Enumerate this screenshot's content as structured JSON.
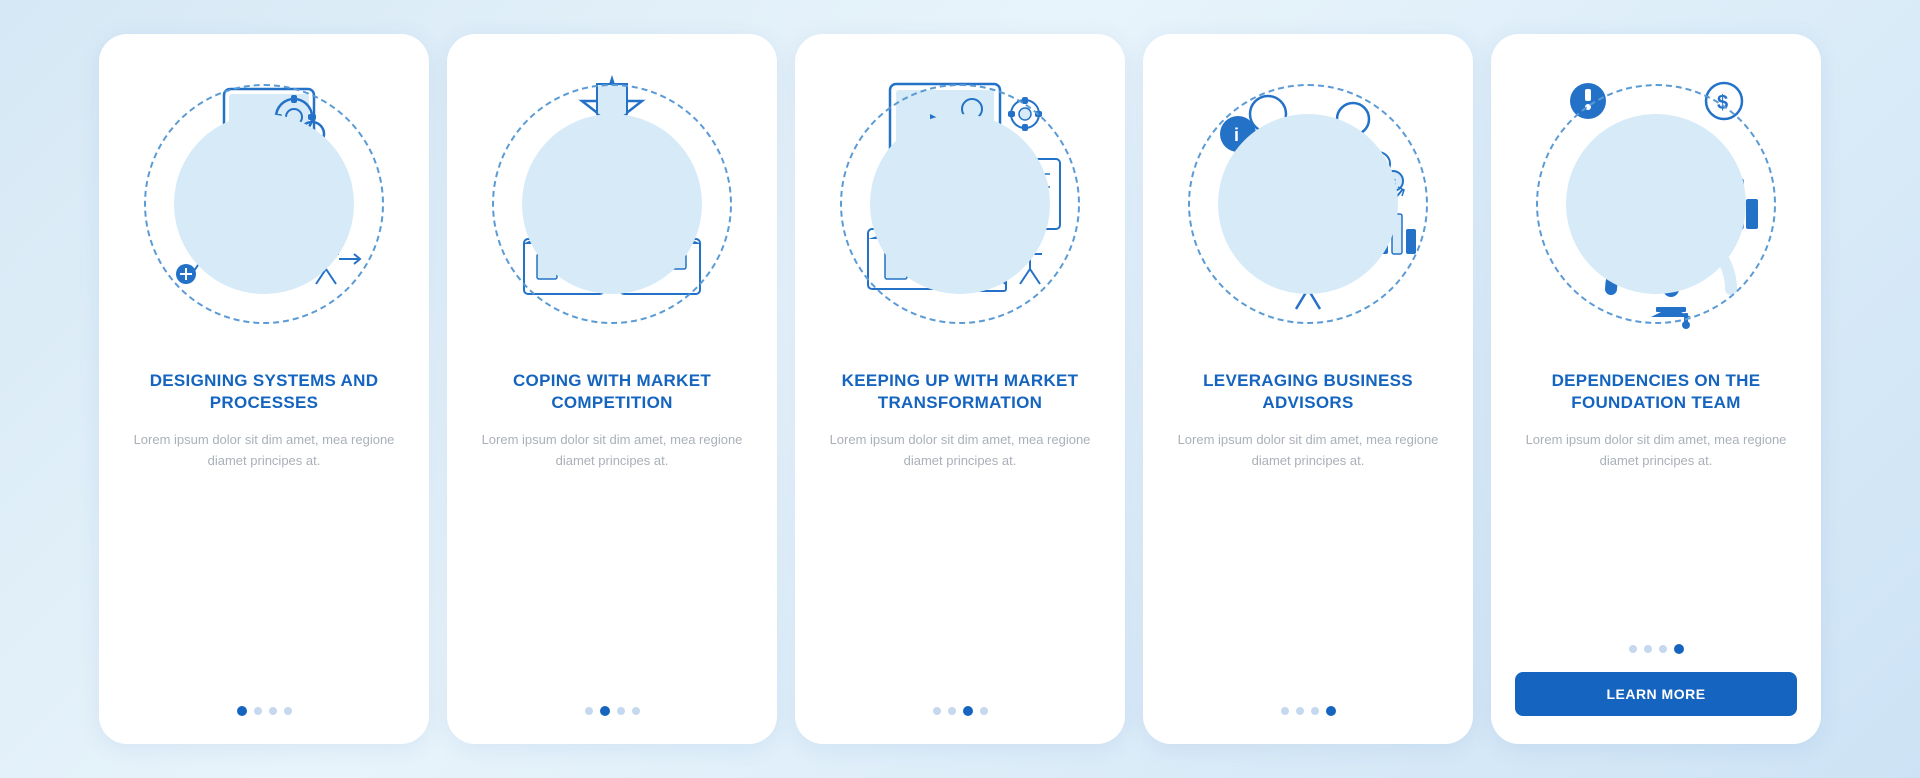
{
  "cards": [
    {
      "id": "card-1",
      "title": "DESIGNING SYSTEMS AND PROCESSES",
      "description": "Lorem ipsum dolor sit dim amet, mea regione diamet principes at.",
      "dots": [
        1,
        2,
        3,
        4
      ],
      "activeDot": 1,
      "showButton": false,
      "buttonLabel": ""
    },
    {
      "id": "card-2",
      "title": "COPING WITH MARKET COMPETITION",
      "description": "Lorem ipsum dolor sit dim amet, mea regione diamet principes at.",
      "dots": [
        1,
        2,
        3,
        4
      ],
      "activeDot": 2,
      "showButton": false,
      "buttonLabel": ""
    },
    {
      "id": "card-3",
      "title": "KEEPING UP WITH MARKET TRANSFORMATION",
      "description": "Lorem ipsum dolor sit dim amet, mea regione diamet principes at.",
      "dots": [
        1,
        2,
        3,
        4
      ],
      "activeDot": 3,
      "showButton": false,
      "buttonLabel": ""
    },
    {
      "id": "card-4",
      "title": "LEVERAGING BUSINESS ADVISORS",
      "description": "Lorem ipsum dolor sit dim amet, mea regione diamet principes at.",
      "dots": [
        1,
        2,
        3,
        4
      ],
      "activeDot": 4,
      "showButton": false,
      "buttonLabel": ""
    },
    {
      "id": "card-5",
      "title": "DEPENDENCIES ON THE FOUNDATION TEAM",
      "description": "Lorem ipsum dolor sit dim amet, mea regione diamet principes at.",
      "dots": [
        1,
        2,
        3,
        4
      ],
      "activeDot": 4,
      "showButton": true,
      "buttonLabel": "LEARN MORE"
    }
  ]
}
